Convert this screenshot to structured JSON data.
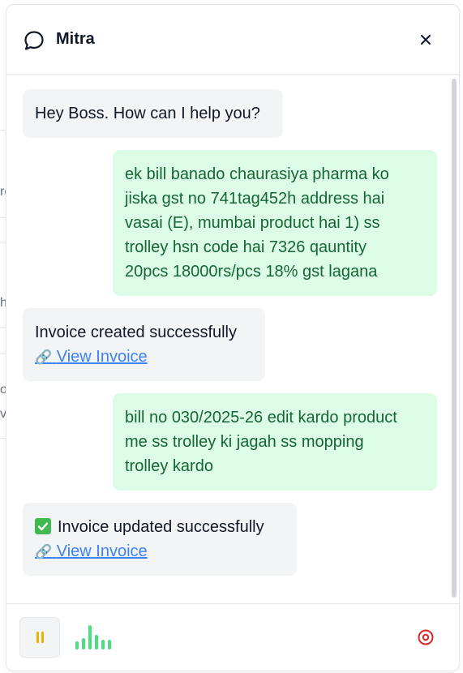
{
  "header": {
    "title": "Mitra",
    "chat_icon": "chat-bubble-icon",
    "close_icon": "close-icon"
  },
  "messages": [
    {
      "role": "bot",
      "text": "Hey Boss. How can I help you?"
    },
    {
      "role": "user",
      "lines": [
        "ek bill banado chaurasiya pharma ko",
        "jiska gst no 741tag452h address hai",
        "vasai (E), mumbai product hai 1) ss",
        "trolley hsn code hai 7326 qauntity",
        "20pcs 18000rs/pcs 18% gst lagana"
      ]
    },
    {
      "role": "bot",
      "text": "Invoice created successfully",
      "link": "View Invoice",
      "link_icon": "🔗"
    },
    {
      "role": "user",
      "lines": [
        "bill no 030/2025-26 edit kardo product",
        "me ss trolley ki jagah ss mopping",
        "trolley kardo"
      ]
    },
    {
      "role": "bot",
      "text": "Invoice updated successfully",
      "status_icon": "check-icon",
      "link": "View Invoice",
      "link_icon": "🔗"
    }
  ],
  "footer": {
    "pause_icon": "pause-icon",
    "wave_icon": "audio-wave-icon",
    "stop_icon": "stop-record-icon"
  },
  "colors": {
    "user_bubble": "#dcfce7",
    "user_text": "#166534",
    "bot_bubble": "#f3f4f6",
    "link": "#3b82f6",
    "wave": "#4ade80",
    "stop": "#dc2626",
    "pause": "#eab308"
  },
  "background_fragments": [
    "re",
    "h",
    "o",
    "vi"
  ]
}
